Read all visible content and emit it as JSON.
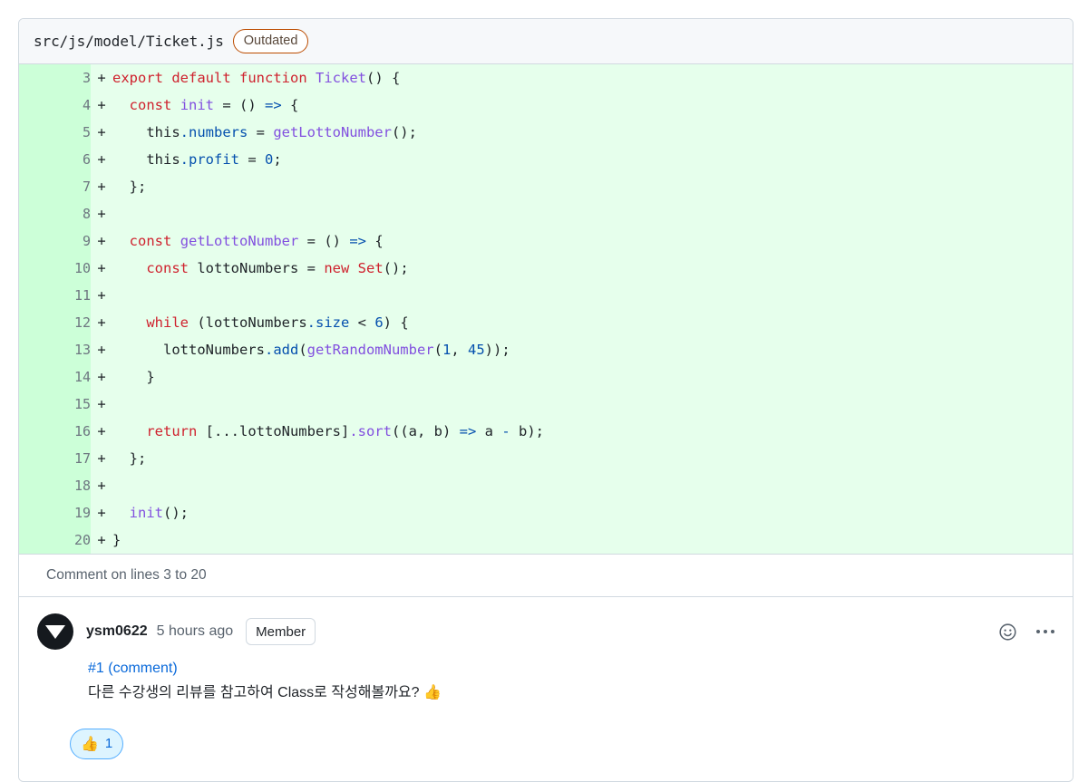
{
  "file_header": {
    "path": "src/js/model/Ticket.js",
    "badge": "Outdated"
  },
  "diff": {
    "lines": [
      {
        "num": "3",
        "marker": "+",
        "tokens": [
          {
            "t": "export",
            "c": "t-kw"
          },
          {
            "t": " ",
            "c": "t-txt"
          },
          {
            "t": "default",
            "c": "t-kw"
          },
          {
            "t": " ",
            "c": "t-txt"
          },
          {
            "t": "function",
            "c": "t-kw"
          },
          {
            "t": " ",
            "c": "t-txt"
          },
          {
            "t": "Ticket",
            "c": "t-fn"
          },
          {
            "t": "() {",
            "c": "t-txt"
          }
        ]
      },
      {
        "num": "4",
        "marker": "+",
        "tokens": [
          {
            "t": "  ",
            "c": "t-txt"
          },
          {
            "t": "const",
            "c": "t-kw"
          },
          {
            "t": " ",
            "c": "t-txt"
          },
          {
            "t": "init",
            "c": "t-fn"
          },
          {
            "t": " = () ",
            "c": "t-txt"
          },
          {
            "t": "=>",
            "c": "t-op"
          },
          {
            "t": " {",
            "c": "t-txt"
          }
        ]
      },
      {
        "num": "5",
        "marker": "+",
        "tokens": [
          {
            "t": "    this",
            "c": "t-txt"
          },
          {
            "t": ".numbers",
            "c": "t-prop"
          },
          {
            "t": " = ",
            "c": "t-txt"
          },
          {
            "t": "getLottoNumber",
            "c": "t-fn"
          },
          {
            "t": "();",
            "c": "t-txt"
          }
        ]
      },
      {
        "num": "6",
        "marker": "+",
        "tokens": [
          {
            "t": "    this",
            "c": "t-txt"
          },
          {
            "t": ".profit",
            "c": "t-prop"
          },
          {
            "t": " = ",
            "c": "t-txt"
          },
          {
            "t": "0",
            "c": "t-num"
          },
          {
            "t": ";",
            "c": "t-txt"
          }
        ]
      },
      {
        "num": "7",
        "marker": "+",
        "tokens": [
          {
            "t": "  };",
            "c": "t-txt"
          }
        ]
      },
      {
        "num": "8",
        "marker": "+",
        "tokens": [
          {
            "t": "",
            "c": "t-txt"
          }
        ]
      },
      {
        "num": "9",
        "marker": "+",
        "tokens": [
          {
            "t": "  ",
            "c": "t-txt"
          },
          {
            "t": "const",
            "c": "t-kw"
          },
          {
            "t": " ",
            "c": "t-txt"
          },
          {
            "t": "getLottoNumber",
            "c": "t-fn"
          },
          {
            "t": " = () ",
            "c": "t-txt"
          },
          {
            "t": "=>",
            "c": "t-op"
          },
          {
            "t": " {",
            "c": "t-txt"
          }
        ]
      },
      {
        "num": "10",
        "marker": "+",
        "tokens": [
          {
            "t": "    ",
            "c": "t-txt"
          },
          {
            "t": "const",
            "c": "t-kw"
          },
          {
            "t": " lottoNumbers = ",
            "c": "t-txt"
          },
          {
            "t": "new",
            "c": "t-kw"
          },
          {
            "t": " ",
            "c": "t-txt"
          },
          {
            "t": "Set",
            "c": "t-kw"
          },
          {
            "t": "();",
            "c": "t-txt"
          }
        ]
      },
      {
        "num": "11",
        "marker": "+",
        "tokens": [
          {
            "t": "",
            "c": "t-txt"
          }
        ]
      },
      {
        "num": "12",
        "marker": "+",
        "tokens": [
          {
            "t": "    ",
            "c": "t-txt"
          },
          {
            "t": "while",
            "c": "t-kw"
          },
          {
            "t": " (lottoNumbers",
            "c": "t-txt"
          },
          {
            "t": ".size",
            "c": "t-prop"
          },
          {
            "t": " < ",
            "c": "t-txt"
          },
          {
            "t": "6",
            "c": "t-num"
          },
          {
            "t": ") {",
            "c": "t-txt"
          }
        ]
      },
      {
        "num": "13",
        "marker": "+",
        "tokens": [
          {
            "t": "      lottoNumbers",
            "c": "t-txt"
          },
          {
            "t": ".add",
            "c": "t-prop"
          },
          {
            "t": "(",
            "c": "t-txt"
          },
          {
            "t": "getRandomNumber",
            "c": "t-fn"
          },
          {
            "t": "(",
            "c": "t-txt"
          },
          {
            "t": "1",
            "c": "t-num"
          },
          {
            "t": ", ",
            "c": "t-txt"
          },
          {
            "t": "45",
            "c": "t-num"
          },
          {
            "t": "));",
            "c": "t-txt"
          }
        ]
      },
      {
        "num": "14",
        "marker": "+",
        "tokens": [
          {
            "t": "    }",
            "c": "t-txt"
          }
        ]
      },
      {
        "num": "15",
        "marker": "+",
        "tokens": [
          {
            "t": "",
            "c": "t-txt"
          }
        ]
      },
      {
        "num": "16",
        "marker": "+",
        "tokens": [
          {
            "t": "    ",
            "c": "t-txt"
          },
          {
            "t": "return",
            "c": "t-kw"
          },
          {
            "t": " [...lottoNumbers]",
            "c": "t-txt"
          },
          {
            "t": ".sort",
            "c": "t-fn"
          },
          {
            "t": "((a, b) ",
            "c": "t-txt"
          },
          {
            "t": "=>",
            "c": "t-op"
          },
          {
            "t": " a ",
            "c": "t-txt"
          },
          {
            "t": "-",
            "c": "t-op"
          },
          {
            "t": " b);",
            "c": "t-txt"
          }
        ]
      },
      {
        "num": "17",
        "marker": "+",
        "tokens": [
          {
            "t": "  };",
            "c": "t-txt"
          }
        ]
      },
      {
        "num": "18",
        "marker": "+",
        "tokens": [
          {
            "t": "",
            "c": "t-txt"
          }
        ]
      },
      {
        "num": "19",
        "marker": "+",
        "tokens": [
          {
            "t": "  ",
            "c": "t-txt"
          },
          {
            "t": "init",
            "c": "t-fn"
          },
          {
            "t": "();",
            "c": "t-txt"
          }
        ]
      },
      {
        "num": "20",
        "marker": "+",
        "tokens": [
          {
            "t": "}",
            "c": "t-txt"
          }
        ]
      }
    ]
  },
  "comment_on_lines": "Comment on lines 3 to 20",
  "comment": {
    "author": "ysm0622",
    "timestamp": "5 hours ago",
    "role_badge": "Member",
    "link_text": "#1 (comment)",
    "body": "다른 수강생의 리뷰를 참고하여 Class로 작성해볼까요? 👍",
    "add_reaction_icon": "smiley-icon",
    "more_options_icon": "kebab-icon"
  },
  "reaction": {
    "emoji": "👍",
    "count": "1"
  },
  "colors": {
    "diff_add_bg": "#e6ffec",
    "diff_add_gutter_bg": "#ccffd8",
    "border": "#d1d9e0",
    "header_bg": "#f6f8fa",
    "link": "#0969da",
    "outdated_border": "#bc4c00",
    "reaction_bg": "#ddf4ff",
    "reaction_border": "#54aeff",
    "keyword": "#cf222e",
    "function": "#8250df",
    "property": "#0550ae"
  }
}
